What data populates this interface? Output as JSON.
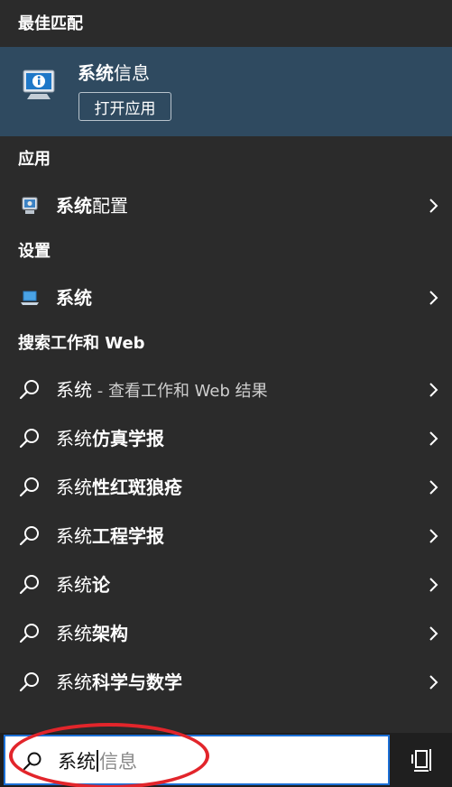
{
  "best_match": {
    "header": "最佳匹配",
    "title_bold": "系统",
    "title_rest": "信息",
    "open_button": "打开应用",
    "icon": "system-info-icon"
  },
  "apps": {
    "header": "应用",
    "items": [
      {
        "bold": "系统",
        "rest": "配置",
        "icon": "system-config-icon"
      }
    ]
  },
  "settings": {
    "header": "设置",
    "items": [
      {
        "bold": "系统",
        "rest": "",
        "icon": "laptop-icon"
      }
    ]
  },
  "web": {
    "header": "搜索工作和 Web",
    "first": {
      "lead": "系统",
      "suffix": " - 查看工作和 Web 结果"
    },
    "items": [
      {
        "lead": "系统",
        "bold": "仿真学报"
      },
      {
        "lead": "系统",
        "bold": "性红斑狼疮"
      },
      {
        "lead": "系统",
        "bold": "工程学报"
      },
      {
        "lead": "系统",
        "bold": "论"
      },
      {
        "lead": "系统",
        "bold": "架构"
      },
      {
        "lead": "系统",
        "bold": "科学与数学"
      }
    ]
  },
  "search": {
    "typed": "系统",
    "suggestion": "信息"
  },
  "colors": {
    "background": "#2b2b2b",
    "best_match_bg": "#2f4a60",
    "highlight": "#e2252b",
    "search_border": "#1b6fd6"
  }
}
